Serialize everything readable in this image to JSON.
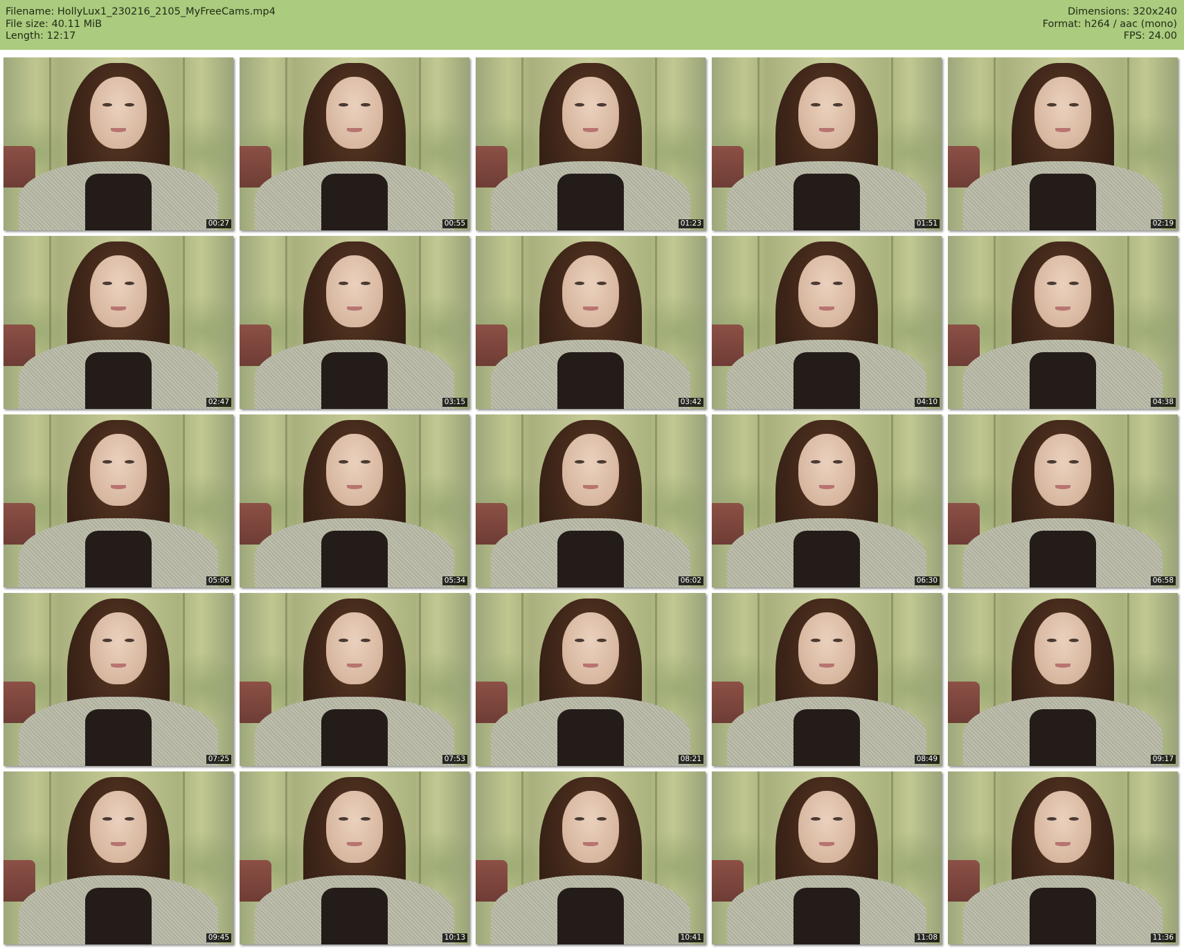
{
  "header": {
    "filename_line": "Filename: HollyLux1_230216_2105_MyFreeCams.mp4",
    "filesize_line": "File size: 40.11 MiB",
    "length_line": "Length: 12:17",
    "dimensions_line": "Dimensions: 320x240",
    "format_line": "Format: h264 / aac (mono)",
    "fps_line": "FPS: 24.00"
  },
  "colors": {
    "header_background": "#abcb7f",
    "page_background": "#ffffff"
  },
  "thumbnails": [
    {
      "timestamp": "00:27"
    },
    {
      "timestamp": "00:55"
    },
    {
      "timestamp": "01:23"
    },
    {
      "timestamp": "01:51"
    },
    {
      "timestamp": "02:19"
    },
    {
      "timestamp": "02:47"
    },
    {
      "timestamp": "03:15"
    },
    {
      "timestamp": "03:42"
    },
    {
      "timestamp": "04:10"
    },
    {
      "timestamp": "04:38"
    },
    {
      "timestamp": "05:06"
    },
    {
      "timestamp": "05:34"
    },
    {
      "timestamp": "06:02"
    },
    {
      "timestamp": "06:30"
    },
    {
      "timestamp": "06:58"
    },
    {
      "timestamp": "07:25"
    },
    {
      "timestamp": "07:53"
    },
    {
      "timestamp": "08:21"
    },
    {
      "timestamp": "08:49"
    },
    {
      "timestamp": "09:17"
    },
    {
      "timestamp": "09:45"
    },
    {
      "timestamp": "10:13"
    },
    {
      "timestamp": "10:41"
    },
    {
      "timestamp": "11:08"
    },
    {
      "timestamp": "11:36"
    }
  ]
}
